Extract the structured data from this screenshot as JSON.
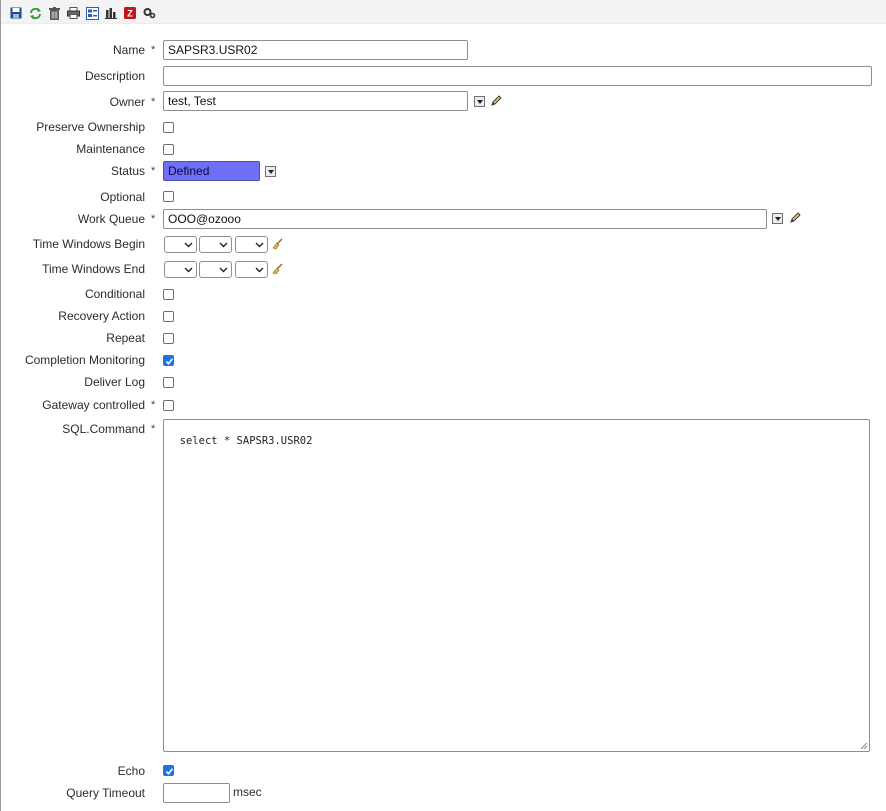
{
  "toolbar": {
    "icons": [
      "save-icon",
      "refresh-icon",
      "delete-icon",
      "print-icon",
      "properties-icon",
      "statistics-icon",
      "export-icon",
      "settings-icon"
    ]
  },
  "form": {
    "name_label": "Name",
    "name_value": "SAPSR3.USR02",
    "description_label": "Description",
    "description_value": "",
    "owner_label": "Owner",
    "owner_value": "test, Test",
    "preserve_ownership_label": "Preserve Ownership",
    "preserve_ownership_checked": false,
    "maintenance_label": "Maintenance",
    "maintenance_checked": false,
    "status_label": "Status",
    "status_value": "Defined",
    "status_color": "#6e6ef7",
    "optional_label": "Optional",
    "optional_checked": false,
    "work_queue_label": "Work Queue",
    "work_queue_value": "OOO@ozooo",
    "time_windows_begin_label": "Time Windows Begin",
    "time_windows_end_label": "Time Windows End",
    "conditional_label": "Conditional",
    "conditional_checked": false,
    "recovery_action_label": "Recovery Action",
    "recovery_action_checked": false,
    "repeat_label": "Repeat",
    "repeat_checked": false,
    "completion_monitoring_label": "Completion Monitoring",
    "completion_monitoring_checked": true,
    "deliver_log_label": "Deliver Log",
    "deliver_log_checked": false,
    "gateway_controlled_label": "Gateway controlled",
    "gateway_controlled_checked": false,
    "sql_command_label": "SQL.Command",
    "sql_command_value": "select * SAPSR3.USR02",
    "echo_label": "Echo",
    "echo_checked": true,
    "query_timeout_label": "Query Timeout",
    "query_timeout_value": "",
    "query_timeout_unit": "msec",
    "required_marker": "*"
  },
  "colors": {
    "checkbox_checked": "#1a73e8",
    "toolbar_bg": "#f3f3f3"
  }
}
